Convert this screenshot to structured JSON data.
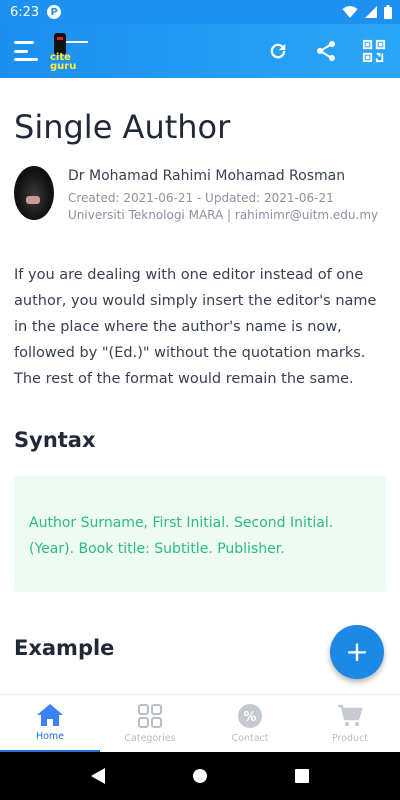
{
  "status_bar": {
    "time": "6:23",
    "app_indicator": "P",
    "icons": [
      "wifi-icon",
      "signal-icon",
      "battery-icon"
    ]
  },
  "app_bar": {
    "logo_text_line1": "cite",
    "logo_text_line2": "guru",
    "actions": [
      "refresh-icon",
      "share-icon",
      "qr-code-icon"
    ]
  },
  "article": {
    "title": "Single Author",
    "author": {
      "name": "Dr Mohamad Rahimi Mohamad Rosman",
      "dates": "Created: 2021-06-21 - Updated: 2021-06-21",
      "affiliation": "Universiti Teknologi MARA | rahimimr@uitm.edu.my"
    },
    "paragraph": "If you are dealing with one editor instead of one author, you would simply insert the editor's name in the place where the author's name is now, followed by \"(Ed.)\" without the quotation marks. The rest of the format would remain the same.",
    "syntax_heading": "Syntax",
    "syntax_text": "Author Surname, First Initial. Second Initial. (Year). Book title: Subtitle. Publisher.",
    "example_heading": "Example"
  },
  "fab": {
    "label": "+"
  },
  "bottom_nav": {
    "items": [
      {
        "label": "Home",
        "icon": "home-icon",
        "active": true
      },
      {
        "label": "Categories",
        "icon": "grid-icon",
        "active": false
      },
      {
        "label": "Contact",
        "icon": "percent-badge-icon",
        "active": false
      },
      {
        "label": "Product",
        "icon": "cart-icon",
        "active": false
      }
    ]
  },
  "colors": {
    "primary": "#1e90f0",
    "accent_green": "#2dbd7a",
    "syntax_bg": "#eefbf4",
    "nav_active": "#1e6fd9",
    "nav_inactive": "#b8bec7"
  }
}
